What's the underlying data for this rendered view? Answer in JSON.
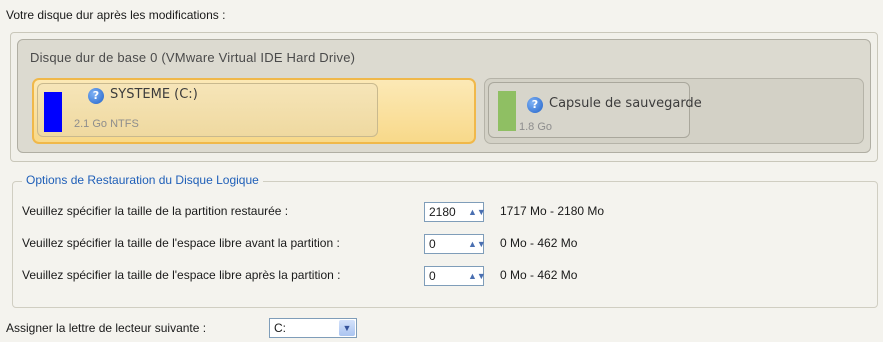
{
  "header": {
    "caption": "Votre disque dur après les modifications :"
  },
  "disk": {
    "title": "Disque dur de base 0 (VMware Virtual IDE Hard Drive)",
    "partitions": [
      {
        "name": "SYSTEME (C:)",
        "sub": "2.1 Go NTFS",
        "color": "#0000ff",
        "icon": "help-icon"
      },
      {
        "name": "Capsule de sauvegarde",
        "sub": "1.8 Go",
        "color": "#8fbf63",
        "icon": "help-icon"
      }
    ]
  },
  "options": {
    "legend": "Options de Restauration du Disque Logique",
    "rows": [
      {
        "label": "Veuillez spécifier la taille de la partition restaurée :",
        "value": "2180",
        "range": "1717 Mo - 2180 Mo"
      },
      {
        "label": "Veuillez spécifier la taille de l'espace libre avant la partition :",
        "value": "0",
        "range": "0 Mo - 462 Mo"
      },
      {
        "label": "Veuillez spécifier la taille de l'espace libre après la partition :",
        "value": "0",
        "range": "0 Mo - 462 Mo"
      }
    ]
  },
  "drive_letter": {
    "label": "Assigner la lettre de lecteur suivante :",
    "value": "C:"
  }
}
